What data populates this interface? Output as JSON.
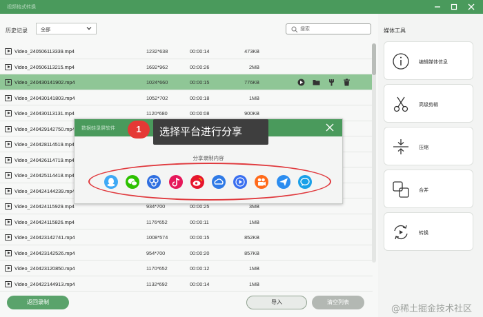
{
  "window": {
    "title": "视频格式转换"
  },
  "toolbar": {
    "history_label": "历史记录",
    "filter_value": "全部",
    "search_placeholder": "搜索"
  },
  "files": [
    {
      "name": "Video_240506113339.mp4",
      "resolution": "1232*638",
      "duration": "00:00:14",
      "size": "473KB"
    },
    {
      "name": "Video_240506113215.mp4",
      "resolution": "1692*962",
      "duration": "00:00:26",
      "size": "2MB"
    },
    {
      "name": "Video_240430141902.mp4",
      "resolution": "1024*660",
      "duration": "00:00:15",
      "size": "776KB",
      "selected": true
    },
    {
      "name": "Video_240430141803.mp4",
      "resolution": "1052*702",
      "duration": "00:00:18",
      "size": "1MB"
    },
    {
      "name": "Video_240430113131.mp4",
      "resolution": "1120*680",
      "duration": "00:00:08",
      "size": "900KB"
    },
    {
      "name": "Video_240429142750.mp4",
      "resolution": "",
      "duration": "",
      "size": ""
    },
    {
      "name": "Video_240428114519.mp4",
      "resolution": "",
      "duration": "",
      "size": ""
    },
    {
      "name": "Video_240426114719.mp4",
      "resolution": "",
      "duration": "",
      "size": ""
    },
    {
      "name": "Video_240425114418.mp4",
      "resolution": "",
      "duration": "",
      "size": ""
    },
    {
      "name": "Video_240424144239.mp4",
      "resolution": "",
      "duration": "",
      "size": ""
    },
    {
      "name": "Video_240424115929.mp4",
      "resolution": "934*700",
      "duration": "00:00:25",
      "size": "3MB"
    },
    {
      "name": "Video_240424115826.mp4",
      "resolution": "1176*652",
      "duration": "00:00:11",
      "size": "1MB"
    },
    {
      "name": "Video_240423142741.mp4",
      "resolution": "1008*574",
      "duration": "00:00:15",
      "size": "852KB"
    },
    {
      "name": "Video_240423142526.mp4",
      "resolution": "954*700",
      "duration": "00:00:20",
      "size": "857KB"
    },
    {
      "name": "Video_240423120850.mp4",
      "resolution": "1170*652",
      "duration": "00:00:12",
      "size": "1MB"
    },
    {
      "name": "Video_240422144913.mp4",
      "resolution": "1132*692",
      "duration": "00:00:14",
      "size": "1MB"
    }
  ],
  "row_actions": [
    "play-icon",
    "folder-icon",
    "tools-icon",
    "trash-icon"
  ],
  "buttons": {
    "back": "返回录制",
    "import": "导入",
    "clear": "清空列表"
  },
  "side": {
    "title": "媒体工具",
    "tools": [
      {
        "label": "编辑媒体信息",
        "icon": "info-icon"
      },
      {
        "label": "高级剪辑",
        "icon": "scissors-icon"
      },
      {
        "label": "压缩",
        "icon": "compress-icon"
      },
      {
        "label": "合并",
        "icon": "merge-icon"
      },
      {
        "label": "转换",
        "icon": "convert-icon"
      }
    ]
  },
  "dialog": {
    "title": "数据蛙录屏软件",
    "share_title": "分享录制内容",
    "platforms": [
      {
        "icon": "qq-icon",
        "color": "#3fa9f5"
      },
      {
        "icon": "wechat-icon",
        "color": "#2dc100"
      },
      {
        "icon": "baidu-icon",
        "color": "#2f6fe0"
      },
      {
        "icon": "douyin-icon",
        "color": "#e6185a"
      },
      {
        "icon": "weibo-icon",
        "color": "#e6162d"
      },
      {
        "icon": "cloud-icon",
        "color": "#2f7ae6"
      },
      {
        "icon": "video-play-icon",
        "color": "#3a6ff0"
      },
      {
        "icon": "kuaishou-icon",
        "color": "#ff6a1a"
      },
      {
        "icon": "send-icon",
        "color": "#2c8df0"
      },
      {
        "icon": "chat-bubble-icon",
        "color": "#1aa0e8"
      }
    ]
  },
  "callout": {
    "step": "1",
    "text": "选择平台进行分享"
  },
  "watermark": "@稀土掘金技术社区",
  "colors": {
    "accent": "#4a9a5c",
    "selected_row": "#8fc696",
    "highlight": "#e03a3e"
  }
}
